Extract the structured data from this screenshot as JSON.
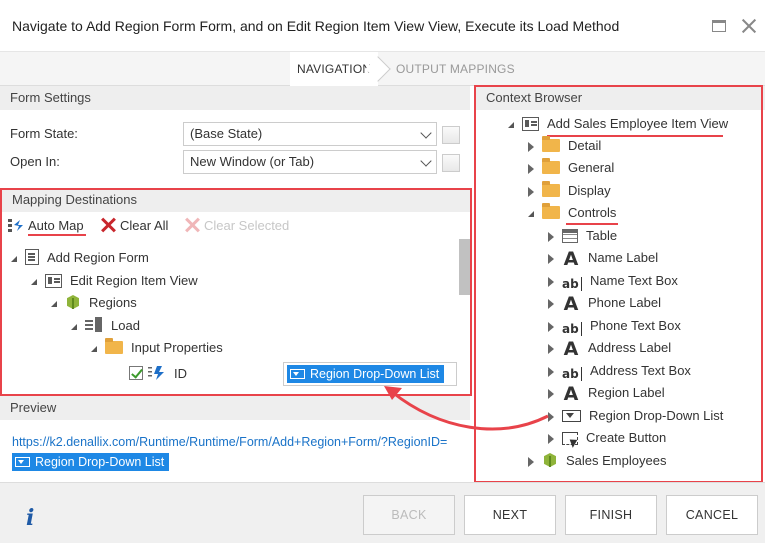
{
  "dialog": {
    "title": "Navigate to Add Region Form Form, and on Edit Region Item View View, Execute its Load Method"
  },
  "wizard": {
    "steps": [
      {
        "label": "NAVIGATION",
        "active": true
      },
      {
        "label": "OUTPUT MAPPINGS",
        "active": false
      }
    ]
  },
  "form_settings": {
    "header": "Form Settings",
    "form_state_label": "Form State:",
    "form_state_value": "(Base State)",
    "open_in_label": "Open In:",
    "open_in_value": "New Window (or Tab)"
  },
  "mapping": {
    "header": "Mapping Destinations",
    "toolbar": {
      "auto_map": "Auto Map",
      "clear_all": "Clear All",
      "clear_selected": "Clear Selected"
    },
    "tree": {
      "form": "Add Region Form",
      "view": "Edit Region Item View",
      "smartobject": "Regions",
      "method": "Load",
      "folder": "Input Properties",
      "property": "ID"
    },
    "mapped_value": "Region Drop-Down List"
  },
  "preview": {
    "header": "Preview",
    "url": "https://k2.denallix.com/Runtime/Runtime/Form/Add+Region+Form/?RegionID=",
    "token": "Region Drop-Down List"
  },
  "context_browser": {
    "header": "Context Browser",
    "root": "Add Sales Employee Item View",
    "groups": [
      "Detail",
      "General",
      "Display"
    ],
    "controls_label": "Controls",
    "controls": [
      {
        "label": "Table",
        "icon": "table-icon"
      },
      {
        "label": "Name Label",
        "icon": "label-icon"
      },
      {
        "label": "Name Text Box",
        "icon": "textbox-icon"
      },
      {
        "label": "Phone Label",
        "icon": "label-icon"
      },
      {
        "label": "Phone Text Box",
        "icon": "textbox-icon"
      },
      {
        "label": "Address Label",
        "icon": "label-icon"
      },
      {
        "label": "Address Text Box",
        "icon": "textbox-icon"
      },
      {
        "label": "Region Label",
        "icon": "label-icon"
      },
      {
        "label": "Region Drop-Down List",
        "icon": "dropdown-icon"
      },
      {
        "label": "Create Button",
        "icon": "button-icon"
      }
    ],
    "sales_employees": "Sales Employees"
  },
  "footer": {
    "back": "BACK",
    "next": "NEXT",
    "finish": "FINISH",
    "cancel": "CANCEL"
  },
  "colors": {
    "annotation_red": "#e8434a",
    "chip_blue": "#1e88e5",
    "link_blue": "#1a73c8"
  }
}
